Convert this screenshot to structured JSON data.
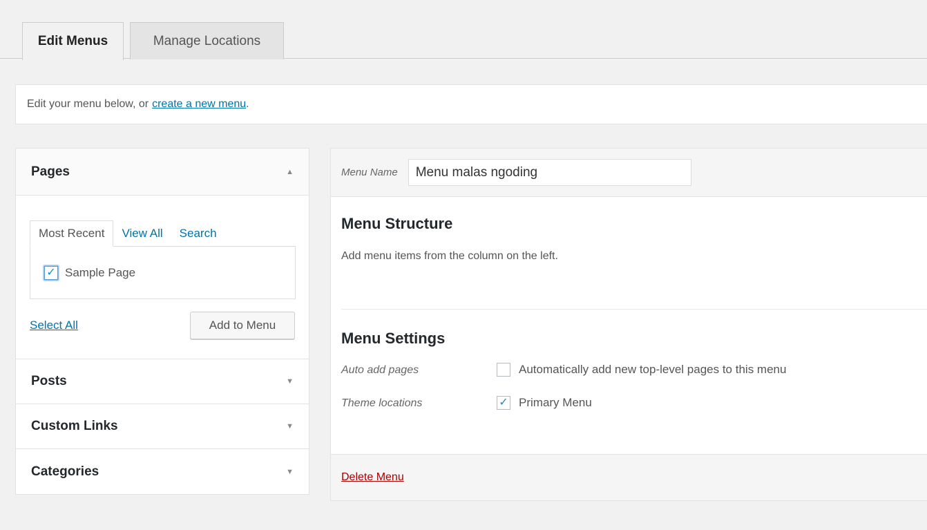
{
  "tabs": [
    {
      "label": "Edit Menus",
      "active": true
    },
    {
      "label": "Manage Locations",
      "active": false
    }
  ],
  "notice": {
    "text": "Edit your menu below, or",
    "link": "create a new menu",
    "suffix": "."
  },
  "left": {
    "pages": {
      "title": "Pages",
      "subtabs": [
        "Most Recent",
        "View All",
        "Search"
      ],
      "items": [
        {
          "label": "Sample Page",
          "checked": true
        }
      ],
      "select_all": "Select All",
      "add_button": "Add to Menu"
    },
    "sections": [
      {
        "title": "Posts"
      },
      {
        "title": "Custom Links"
      },
      {
        "title": "Categories"
      }
    ],
    "arrow_up": "▲",
    "arrow_down": "▼"
  },
  "menu": {
    "name_label": "Menu Name",
    "name_value": "Menu malas ngoding",
    "structure_title": "Menu Structure",
    "structure_desc": "Add menu items from the column on the left.",
    "settings_title": "Menu Settings",
    "auto_add_label": "Auto add pages",
    "auto_add_text": "Automatically add new top-level pages to this menu",
    "auto_add_checked": false,
    "theme_locations_label": "Theme locations",
    "primary_menu_text": "Primary Menu",
    "primary_menu_checked": true,
    "delete_label": "Delete Menu"
  },
  "icons": {
    "check": "✓"
  },
  "colors": {
    "link": "#0073aa",
    "delete": "#aa0000",
    "check": "#1e8cbe"
  }
}
